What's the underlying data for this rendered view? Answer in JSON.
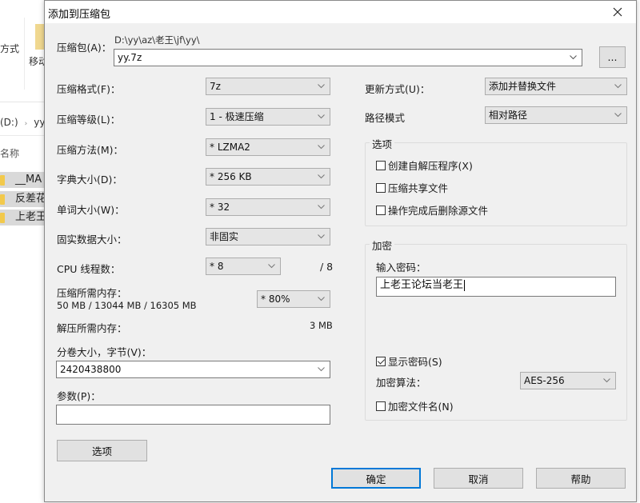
{
  "explorer": {
    "ribbon_text": "方式",
    "move_label": "移动",
    "address": {
      "drive": "(D:)",
      "folder": "yy"
    },
    "column_header": "名称",
    "rows": [
      "__MA",
      "反差花",
      "上老王"
    ]
  },
  "dialog": {
    "title": "添加到压缩包",
    "close_icon": "close-icon",
    "archive": {
      "label": "压缩包(A)：",
      "path": "D:\\yy\\az\\老王\\jf\\yy\\",
      "filename": "yy.7z",
      "browse_label": "..."
    },
    "left": {
      "format": {
        "label": "压缩格式(F)：",
        "value": "7z"
      },
      "level": {
        "label": "压缩等级(L)：",
        "value": "1 - 极速压缩"
      },
      "method": {
        "label": "压缩方法(M)：",
        "value": "* LZMA2"
      },
      "dict": {
        "label": "字典大小(D)：",
        "value": "* 256 KB"
      },
      "word": {
        "label": "单词大小(W)：",
        "value": "* 32"
      },
      "solid": {
        "label": "固实数据大小：",
        "value": "非固实"
      },
      "threads": {
        "label": "CPU 线程数：",
        "value": "* 8",
        "max": "/ 8"
      },
      "mem_compress": {
        "label": "压缩所需内存：",
        "detail": "50 MB / 13044 MB / 16305 MB",
        "value": "* 80%"
      },
      "mem_decompress": {
        "label": "解压所需内存：",
        "value": "3 MB"
      },
      "volume": {
        "label": "分卷大小，字节(V)：",
        "value": "2420438800"
      },
      "params": {
        "label": "参数(P)：",
        "value": ""
      },
      "options_button": "选项"
    },
    "right": {
      "update": {
        "label": "更新方式(U)：",
        "value": "添加并替换文件"
      },
      "path_mode": {
        "label": "路径模式",
        "value": "相对路径"
      },
      "options_group": {
        "title": "选项",
        "items": [
          {
            "label": "创建自解压程序(X)",
            "checked": false
          },
          {
            "label": "压缩共享文件",
            "checked": false
          },
          {
            "label": "操作完成后删除源文件",
            "checked": false
          }
        ]
      },
      "encryption": {
        "title": "加密",
        "password_label": "输入密码：",
        "password_value": "上老王论坛当老王",
        "show_password": {
          "label": "显示密码(S)",
          "checked": true
        },
        "method_label": "加密算法：",
        "method_value": "AES-256",
        "encrypt_names": {
          "label": "加密文件名(N)",
          "checked": false
        }
      }
    },
    "buttons": {
      "ok": "确定",
      "cancel": "取消",
      "help": "帮助"
    }
  }
}
